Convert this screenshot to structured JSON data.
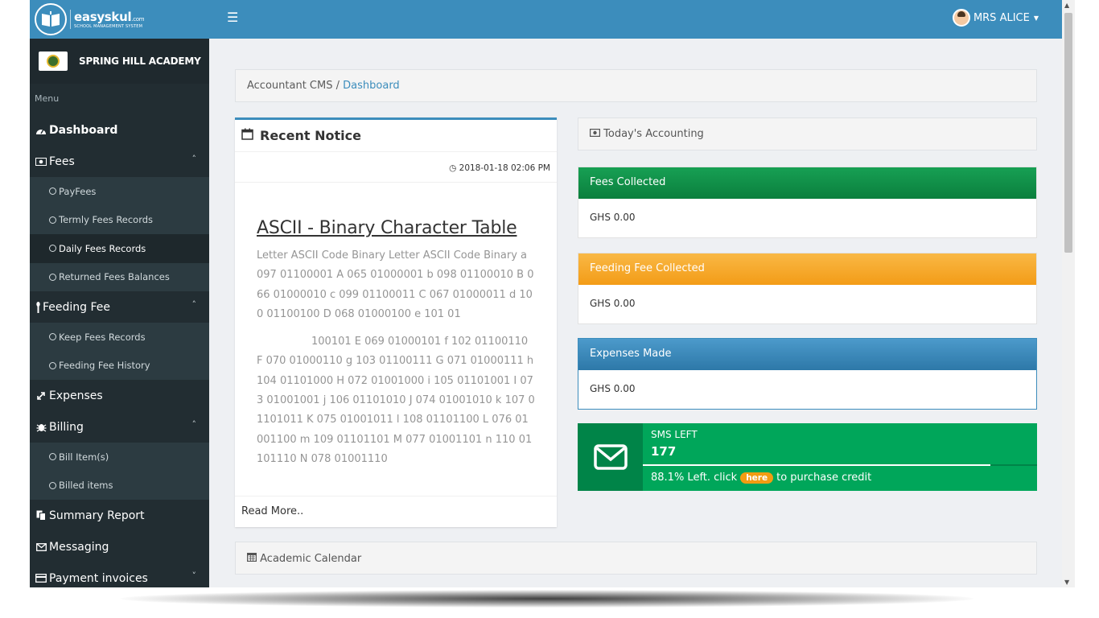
{
  "brand": {
    "name": "easyskul",
    "name_suffix": ".com",
    "tagline": "SCHOOL MANAGEMENT SYSTEM"
  },
  "school": {
    "name": "SPRING HILL ACADEMY"
  },
  "sidebar": {
    "menu_label": "Menu",
    "items": [
      {
        "label": "Dashboard",
        "icon": "dashboard-icon"
      },
      {
        "label": "Fees",
        "icon": "money-icon",
        "children": [
          "PayFees",
          "Termly Fees Records",
          "Daily Fees Records",
          "Returned Fees Balances"
        ]
      },
      {
        "label": "Feeding Fee",
        "icon": "cutlery-icon",
        "children": [
          "Keep Fees Records",
          "Feeding Fee History"
        ]
      },
      {
        "label": "Expenses",
        "icon": "expand-icon"
      },
      {
        "label": "Billing",
        "icon": "bug-icon",
        "children": [
          "Bill Item(s)",
          "Billed items"
        ]
      },
      {
        "label": "Summary Report",
        "icon": "copy-icon"
      },
      {
        "label": "Messaging",
        "icon": "envelope-icon"
      },
      {
        "label": "Payment invoices",
        "icon": "credit-card-icon"
      }
    ],
    "active_child": "Daily Fees Records"
  },
  "header": {
    "user_name": "MRS ALICE"
  },
  "breadcrumb": {
    "root": "Accountant CMS",
    "separator": "/",
    "current": "Dashboard"
  },
  "notice": {
    "title": "Recent Notice",
    "date": "2018-01-18 02:06 PM",
    "heading": "ASCII - Binary Character Table",
    "paragraph1": "Letter ASCII Code Binary Letter ASCII Code Binary a 097 01100001 A 065 01000001 b 098 01100010 B 066 01000010 c 099 01100011 C 067 01000011 d 100 01100100 D 068 01000100 e 101 01",
    "paragraph2": "100101 E 069 01000101 f 102 01100110 F 070 01000110 g 103 01100111 G 071 01000111 h 104 01101000 H 072 01001000 i 105 01101001 I 073 01001001 j 106 01101010 J 074 01001010 k 107 01101011 K 075 01001011 l 108 01101100 L 076 01001100 m 109 01101101 M 077 01001101 n 110 01101110 N 078 01001110",
    "read_more": "Read More.."
  },
  "accounting": {
    "title": "Today's Accounting",
    "fees_collected": {
      "label": "Fees Collected",
      "value": "GHS 0.00"
    },
    "feeding_fee": {
      "label": "Feeding Fee Collected",
      "value": "GHS 0.00"
    },
    "expenses": {
      "label": "Expenses Made",
      "value": "GHS 0.00"
    }
  },
  "sms": {
    "label": "SMS LEFT",
    "count": "177",
    "percent_text": "88.1% Left. click",
    "here": "here",
    "purchase": "to purchase credit",
    "progress": 0.881
  },
  "calendar": {
    "title": "Academic Calendar"
  },
  "colors": {
    "primary": "#3c8dbc",
    "sidebar": "#222d32",
    "green": "#00a65a",
    "orange": "#f39c12"
  }
}
